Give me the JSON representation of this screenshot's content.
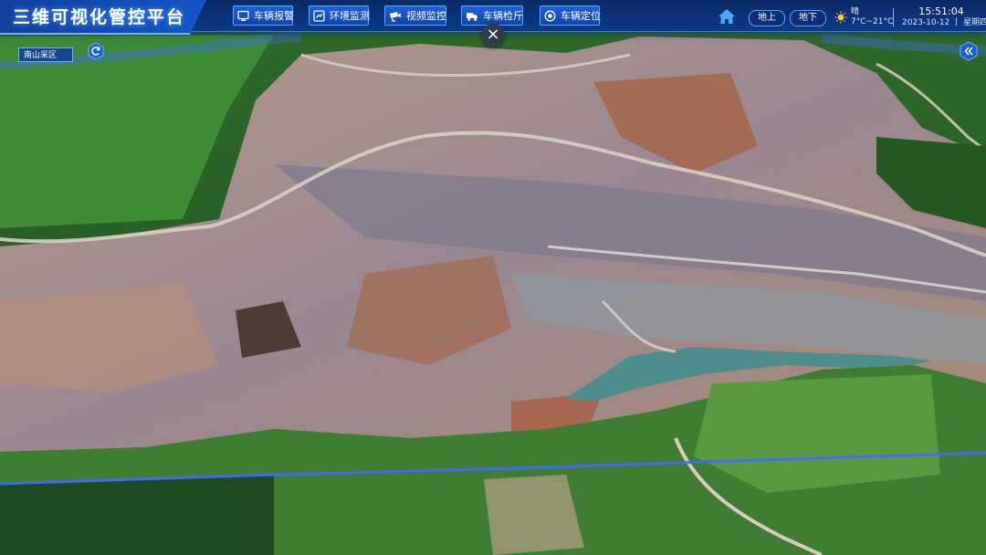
{
  "app": {
    "title": "三维可视化管控平台"
  },
  "nav": [
    {
      "label": "车辆报警",
      "icon": "alarm-monitor-icon"
    },
    {
      "label": "环境监测",
      "icon": "environment-screen-icon"
    },
    {
      "label": "视频监控",
      "icon": "camera-icon"
    },
    {
      "label": "车辆检斤",
      "icon": "truck-icon"
    },
    {
      "label": "车辆定位",
      "icon": "location-target-icon"
    }
  ],
  "layers": {
    "above": "地上",
    "below": "地下"
  },
  "weather": {
    "condition": "晴",
    "temperature": "7°C~21°C",
    "icon": "sun-icon"
  },
  "clock": {
    "time": "15:51:04",
    "date": "2023-10-12",
    "weekday": "星期四"
  },
  "overlay": {
    "region": "南山采区",
    "close_symbol": "×"
  },
  "colors": {
    "header": "#0b3a86",
    "accent": "#5aa5ff",
    "border_line": "#3d6bff"
  }
}
